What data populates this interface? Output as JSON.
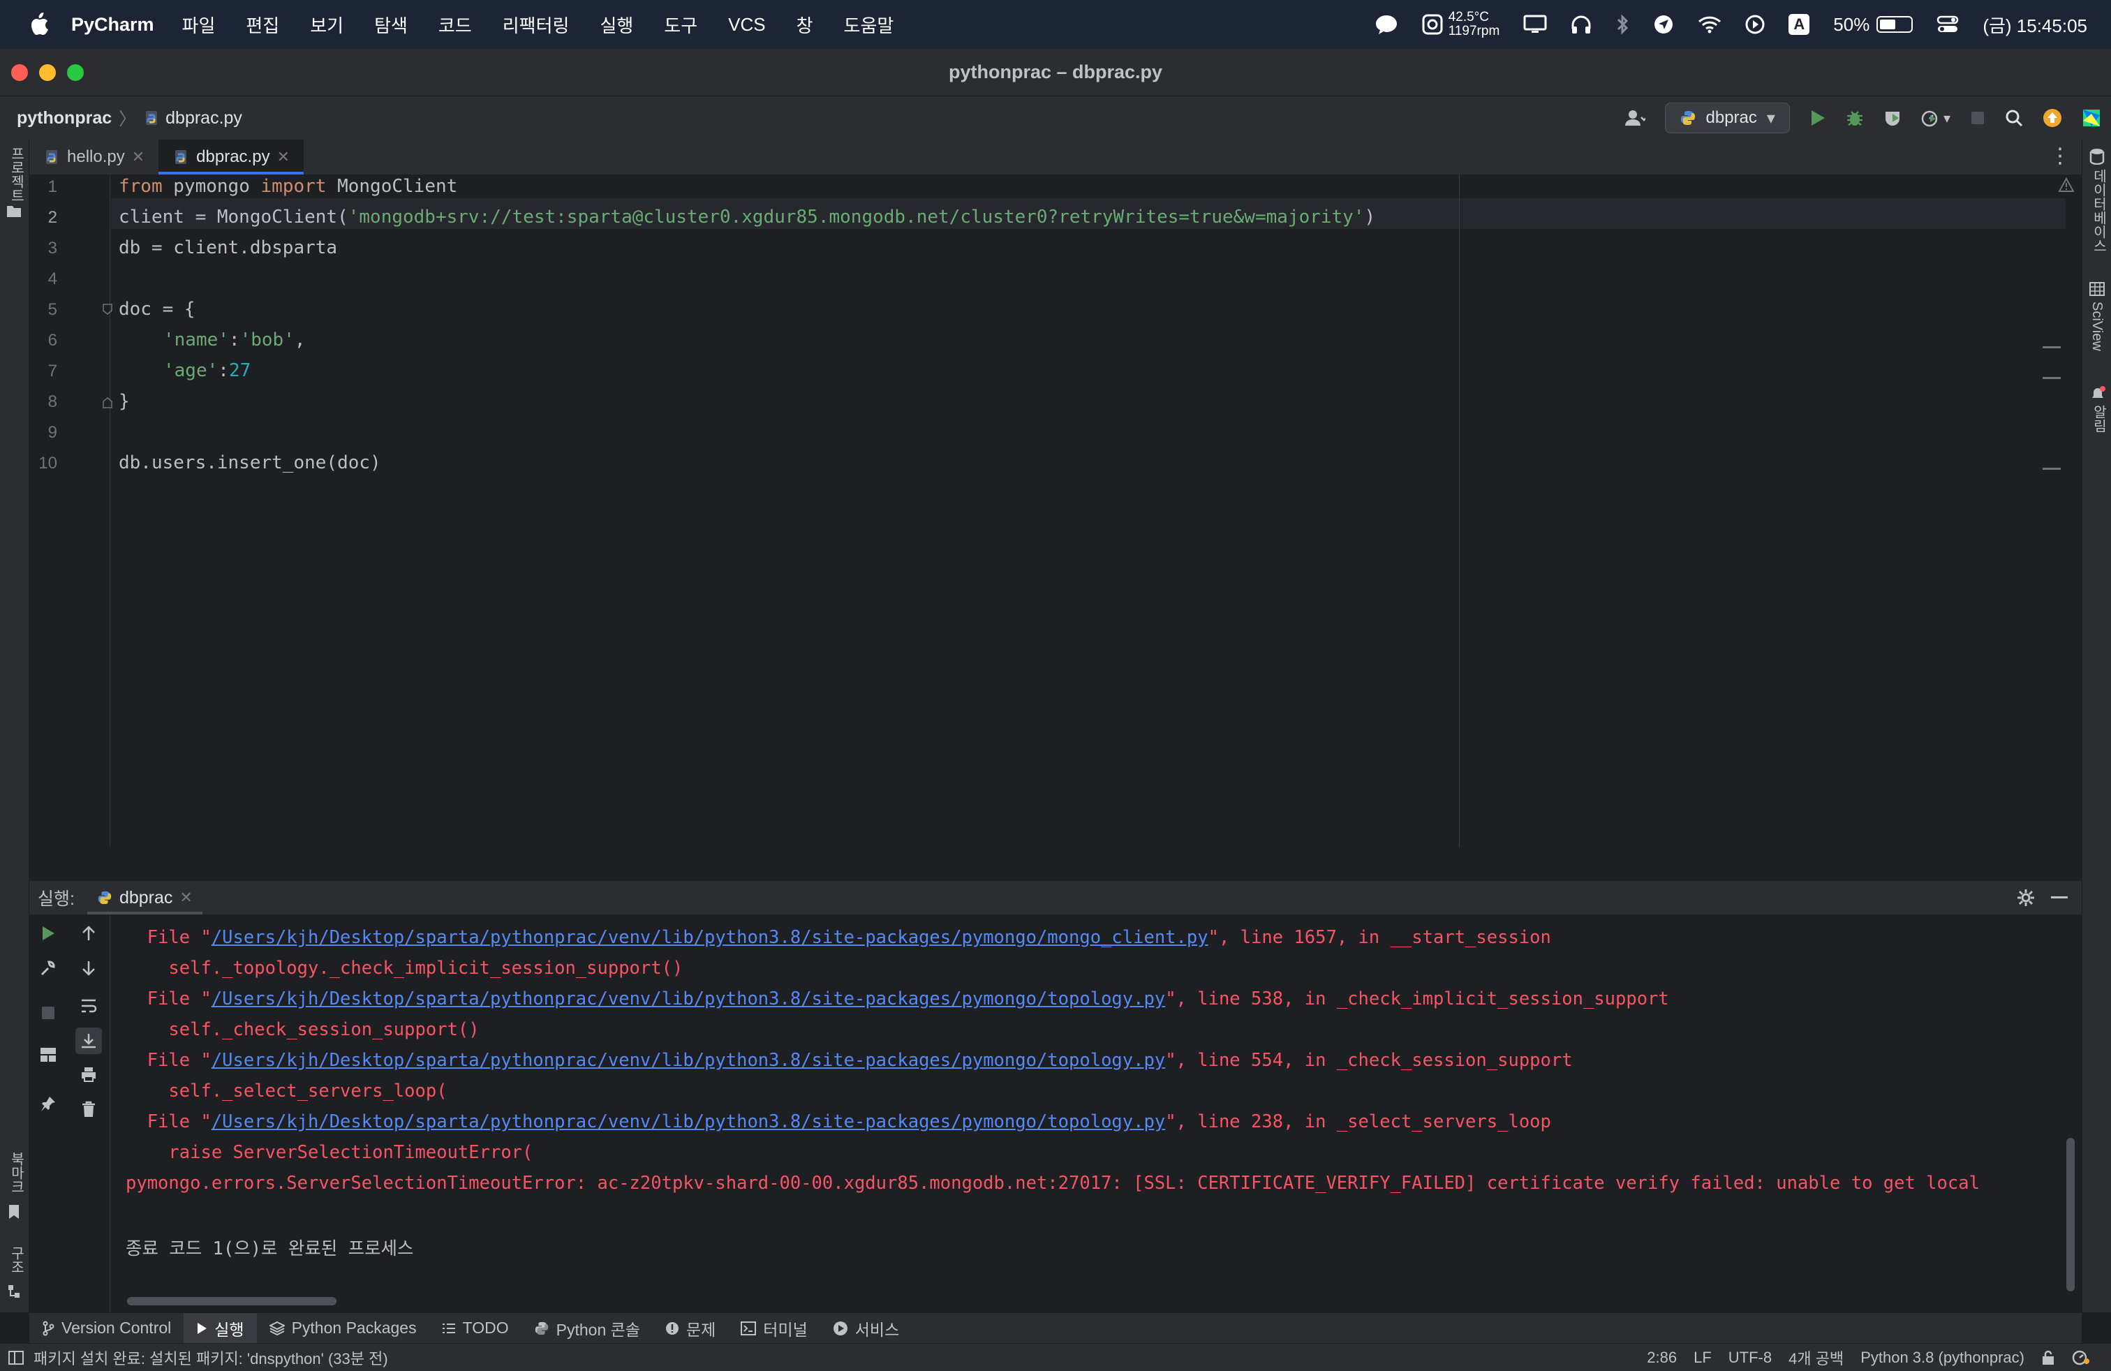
{
  "menubar": {
    "app_name": "PyCharm",
    "items": [
      "파일",
      "편집",
      "보기",
      "탐색",
      "코드",
      "리팩터링",
      "실행",
      "도구",
      "VCS",
      "창",
      "도움말"
    ],
    "temp_line1": "42.5°C",
    "temp_line2": "1197rpm",
    "input_source": "A",
    "battery": "50%",
    "battery_level": 0.5,
    "clock": "(금) 15:45:05"
  },
  "window": {
    "title": "pythonprac – dbprac.py"
  },
  "breadcrumb": {
    "project": "pythonprac",
    "file": "dbprac.py"
  },
  "toolbar": {
    "run_config": "dbprac"
  },
  "left_strip": {
    "project_label": "프로젝트",
    "bookmarks_label": "북마크",
    "structure_label": "구조"
  },
  "right_strip": {
    "database_label": "데이터베이스",
    "sciview_label": "SciView",
    "notifications_label": "알림"
  },
  "tabs": [
    {
      "label": "hello.py",
      "active": false
    },
    {
      "label": "dbprac.py",
      "active": true
    }
  ],
  "editor": {
    "current_line": 2,
    "line_numbers": [
      "1",
      "2",
      "3",
      "4",
      "5",
      "6",
      "7",
      "8",
      "9",
      "10"
    ]
  },
  "code": {
    "l1_kw1": "from",
    "l1_mod": " pymongo ",
    "l1_kw2": "import",
    "l1_name": " MongoClient",
    "l2_pre": "client = MongoClient(",
    "l2_str": "'mongodb+srv://test:sparta@cluster0.xgdur85.mongodb.net/cluster0?retryWrites=true&w=majority'",
    "l2_post": ")",
    "l3": "db = client.dbsparta",
    "l5": "doc = {",
    "l6_str1": "'name'",
    "l6_mid": ":",
    "l6_str2": "'bob'",
    "l6_end": ",",
    "l7_str": "'age'",
    "l7_mid": ":",
    "l7_num": "27",
    "l8": "}",
    "l10": "db.users.insert_one(doc)"
  },
  "run_panel": {
    "label": "실행:",
    "config": "dbprac",
    "lines": [
      {
        "pre": "  File \"",
        "link": "/Users/kjh/Desktop/sparta/pythonprac/venv/lib/python3.8/site-packages/pymongo/mongo_client.py",
        "post": "\", line 1657, in __start_session"
      },
      {
        "text": "    self._topology._check_implicit_session_support()"
      },
      {
        "pre": "  File \"",
        "link": "/Users/kjh/Desktop/sparta/pythonprac/venv/lib/python3.8/site-packages/pymongo/topology.py",
        "post": "\", line 538, in _check_implicit_session_support"
      },
      {
        "text": "    self._check_session_support()"
      },
      {
        "pre": "  File \"",
        "link": "/Users/kjh/Desktop/sparta/pythonprac/venv/lib/python3.8/site-packages/pymongo/topology.py",
        "post": "\", line 554, in _check_session_support"
      },
      {
        "text": "    self._select_servers_loop("
      },
      {
        "pre": "  File \"",
        "link": "/Users/kjh/Desktop/sparta/pythonprac/venv/lib/python3.8/site-packages/pymongo/topology.py",
        "post": "\", line 238, in _select_servers_loop"
      },
      {
        "text": "    raise ServerSelectionTimeoutError("
      },
      {
        "text": "pymongo.errors.ServerSelectionTimeoutError: ac-z20tpkv-shard-00-00.xgdur85.mongodb.net:27017: [SSL: CERTIFICATE_VERIFY_FAILED] certificate verify failed: unable to get local"
      }
    ],
    "exit_message": "종료 코드 1(으)로 완료된 프로세스"
  },
  "tool_tabs": [
    "Version Control",
    "실행",
    "Python Packages",
    "TODO",
    "Python 콘솔",
    "문제",
    "터미널",
    "서비스"
  ],
  "statusbar": {
    "message": "패키지 설치 완료: 설치된 패키지: 'dnspython' (33분 전)",
    "position": "2:86",
    "line_sep": "LF",
    "encoding": "UTF-8",
    "indent": "4개 공백",
    "interpreter": "Python 3.8 (pythonprac)"
  },
  "colors": {
    "keyword": "#cf8e6d",
    "string": "#6aab73",
    "number": "#2aacb8",
    "error": "#f75464",
    "link": "#548af7",
    "accent": "#3574f0"
  }
}
